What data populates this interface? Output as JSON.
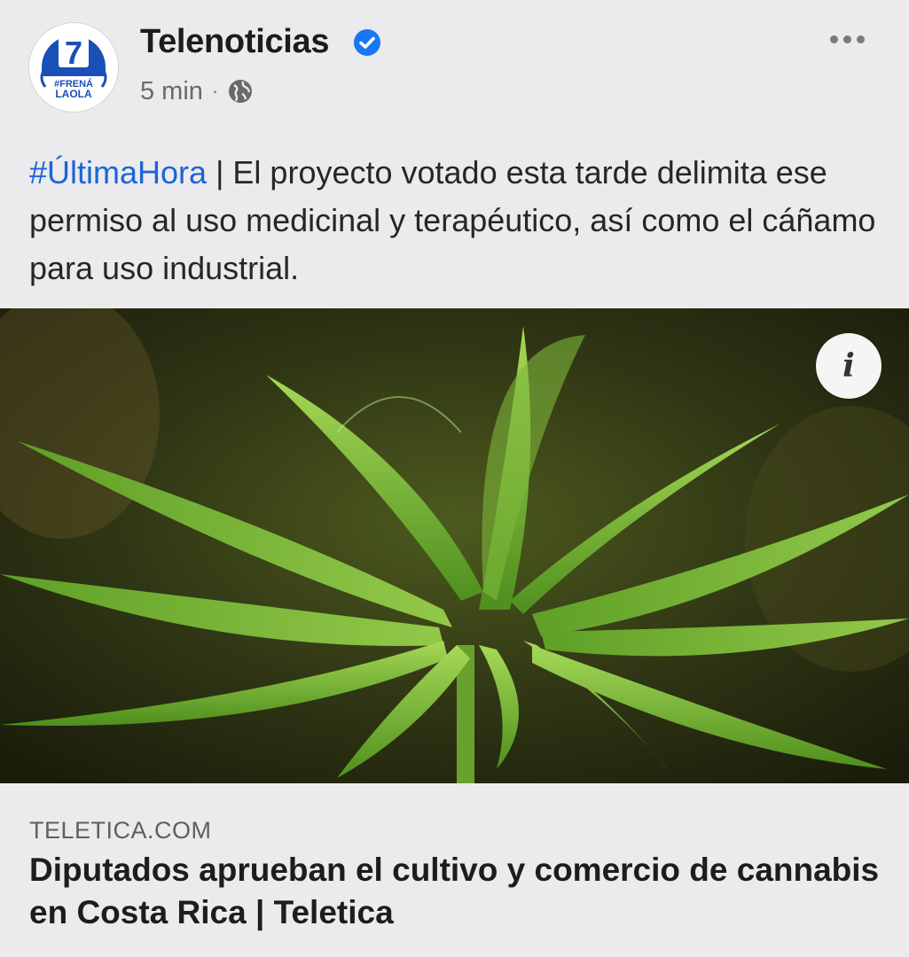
{
  "post": {
    "page_name": "Telenoticias",
    "time": "5 min",
    "separator": "·",
    "avatar": {
      "number": "7",
      "slogan_line1": "#FRENÁ",
      "slogan_line2": "LAOLA"
    },
    "icons": {
      "verified": "verified-badge-icon",
      "audience": "globe-icon",
      "more": "more-options-icon"
    },
    "text": {
      "hashtag": "#ÚltimaHora",
      "body": " | El proyecto votado esta tarde delimita ese permiso al uso medicinal y terapéutico, así como el cáñamo para uso industrial."
    },
    "image": {
      "info_label": "i"
    },
    "link": {
      "domain": "TELETICA.COM",
      "title": "Diputados aprueban el cultivo y comercio de cannabis en Costa Rica | Teletica"
    },
    "colors": {
      "hashtag": "#1d64d8",
      "verified": "#1877f2",
      "brand": "#1a4fb5"
    }
  }
}
